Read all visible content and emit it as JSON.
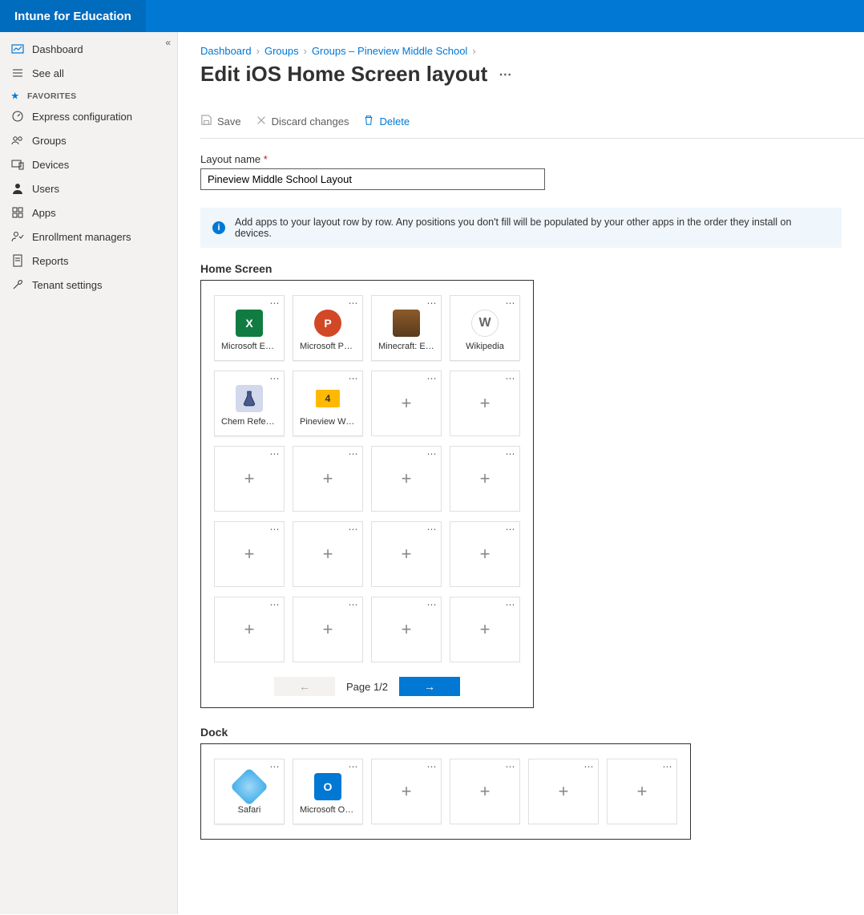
{
  "brand": "Intune for Education",
  "sidebar": {
    "items": [
      {
        "label": "Dashboard"
      },
      {
        "label": "See all"
      }
    ],
    "favoritesLabel": "FAVORITES",
    "favorites": [
      {
        "label": "Express configuration"
      },
      {
        "label": "Groups"
      },
      {
        "label": "Devices"
      },
      {
        "label": "Users"
      },
      {
        "label": "Apps"
      },
      {
        "label": "Enrollment managers"
      },
      {
        "label": "Reports"
      },
      {
        "label": "Tenant settings"
      }
    ]
  },
  "breadcrumb": {
    "items": [
      "Dashboard",
      "Groups",
      "Groups – Pineview Middle School"
    ]
  },
  "page": {
    "title": "Edit iOS Home Screen layout"
  },
  "toolbar": {
    "save": "Save",
    "discard": "Discard changes",
    "delete": "Delete"
  },
  "form": {
    "layoutNameLabel": "Layout name",
    "layoutNameValue": "Pineview Middle School Layout"
  },
  "banner": {
    "text": "Add apps to your layout row by row. Any positions you don't fill will be populated by your other apps in the order they install on devices."
  },
  "homeScreen": {
    "title": "Home Screen",
    "slots": [
      {
        "name": "Microsoft Excel",
        "icon": "excel"
      },
      {
        "name": "Microsoft PowerPoint",
        "icon": "ppt"
      },
      {
        "name": "Minecraft: Education Edition",
        "icon": "mc"
      },
      {
        "name": "Wikipedia",
        "icon": "wiki"
      },
      {
        "name": "Chem Reference",
        "icon": "chem"
      },
      {
        "name": "Pineview Web Clips",
        "icon": "fold",
        "badge": "4"
      },
      null,
      null,
      null,
      null,
      null,
      null,
      null,
      null,
      null,
      null,
      null,
      null,
      null,
      null
    ],
    "pageLabel": "Page 1/2"
  },
  "dock": {
    "title": "Dock",
    "slots": [
      {
        "name": "Safari",
        "icon": "safari"
      },
      {
        "name": "Microsoft Outlook",
        "icon": "outlook"
      },
      null,
      null,
      null,
      null
    ]
  }
}
